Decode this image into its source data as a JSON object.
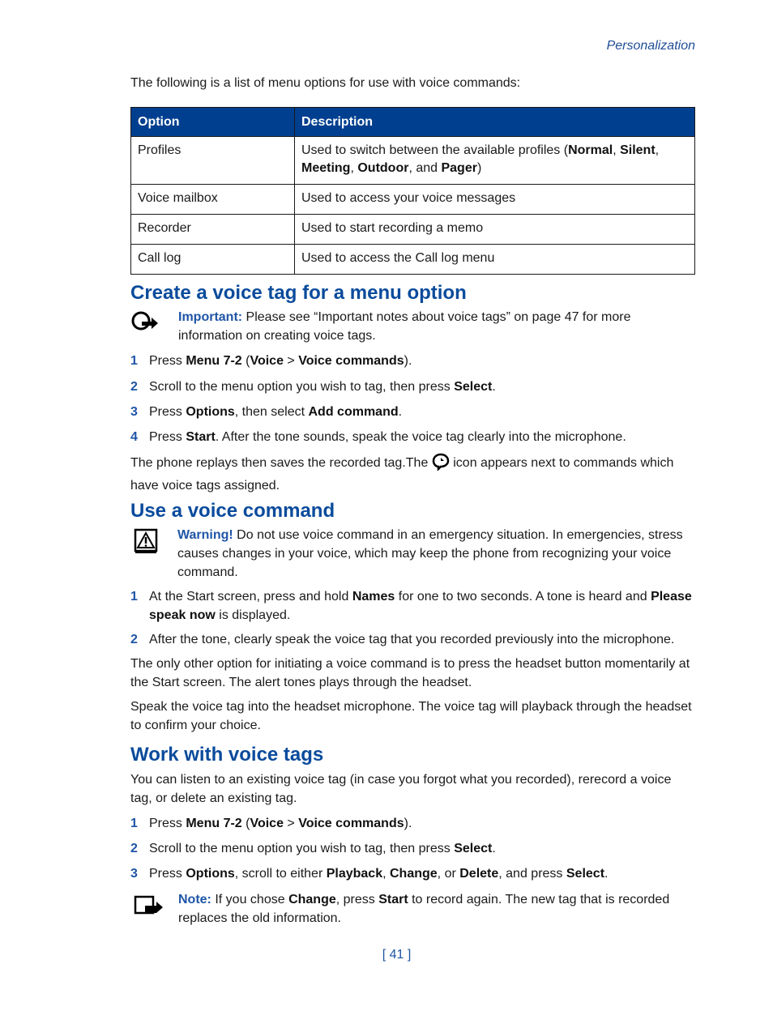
{
  "running_head": "Personalization",
  "intro": "The following is a list of menu options for use with voice commands:",
  "table": {
    "headers": [
      "Option",
      "Description"
    ],
    "rows": [
      {
        "option": "Profiles",
        "desc_pre": "Used to switch between the available profiles (",
        "desc_b1": "Normal",
        "desc_s1": ", ",
        "desc_b2": "Silent",
        "desc_s2": ", ",
        "desc_b3": "Meeting",
        "desc_s3": ", ",
        "desc_b4": "Outdoor",
        "desc_s4": ", and ",
        "desc_b5": "Pager",
        "desc_post": ")"
      },
      {
        "option": "Voice mailbox",
        "description": "Used to access your voice messages"
      },
      {
        "option": "Recorder",
        "description": "Used to start recording a memo"
      },
      {
        "option": "Call log",
        "description": "Used to access the Call log menu"
      }
    ]
  },
  "section1": {
    "heading": "Create a voice tag for a menu option",
    "important_label": "Important:",
    "important_text": " Please see “Important notes about voice tags” on page 47 for more information on creating voice tags.",
    "steps": [
      {
        "num": "1",
        "t0": "Press ",
        "b0": "Menu 7-2",
        "t1": " (",
        "b1": "Voice",
        "t2": " > ",
        "b2": "Voice commands",
        "t3": ")."
      },
      {
        "num": "2",
        "t0": "Scroll to the menu option you wish to tag, then press ",
        "b0": "Select",
        "t1": "."
      },
      {
        "num": "3",
        "t0": "Press ",
        "b0": "Options",
        "t1": ", then select ",
        "b1": "Add command",
        "t2": "."
      },
      {
        "num": "4",
        "t0": "Press ",
        "b0": "Start",
        "t1": ". After the tone sounds, speak the voice tag clearly into the microphone."
      }
    ],
    "after_pre": "The phone replays then saves the recorded tag.The ",
    "after_post": " icon appears next to commands which have voice tags assigned."
  },
  "section2": {
    "heading": "Use a voice command",
    "warning_label": "Warning!",
    "warning_text": " Do not use voice command in an emergency situation. In emergencies, stress causes changes in your voice, which may keep the phone from recognizing your voice command.",
    "steps": [
      {
        "num": "1",
        "t0": "At the Start screen, press and hold ",
        "b0": "Names",
        "t1": " for one to two seconds. A tone is heard and ",
        "b1": "Please speak now",
        "t2": " is displayed."
      },
      {
        "num": "2",
        "t0": "After the tone, clearly speak the voice tag that you recorded previously into the microphone."
      }
    ],
    "para1": "The only other option for initiating a voice command is to press the headset button momentarily at the Start screen. The alert tones plays through the headset.",
    "para2": "Speak the voice tag into the headset microphone. The voice tag will playback through the headset to confirm your choice."
  },
  "section3": {
    "heading": "Work with voice tags",
    "intro": "You can listen to an existing voice tag (in case you forgot what you recorded), rerecord a voice tag, or delete an existing tag.",
    "steps": [
      {
        "num": "1",
        "t0": "Press ",
        "b0": "Menu 7-2",
        "t1": " (",
        "b1": "Voice",
        "t2": " > ",
        "b2": "Voice commands",
        "t3": ")."
      },
      {
        "num": "2",
        "t0": "Scroll to the menu option you wish to tag, then press ",
        "b0": "Select",
        "t1": "."
      },
      {
        "num": "3",
        "t0": "Press ",
        "b0": "Options",
        "t1": ", scroll to either ",
        "b1": "Playback",
        "t2": ", ",
        "b2": "Change",
        "t3": ", or ",
        "b3": "Delete",
        "t4": ", and press ",
        "b4": "Select",
        "t5": "."
      }
    ],
    "note_label": "Note:",
    "note_t0": " If you chose ",
    "note_b0": "Change",
    "note_t1": ", press ",
    "note_b1": "Start",
    "note_t2": " to record again. The new tag that is recorded replaces the old information."
  },
  "page_number": "[ 41 ]"
}
